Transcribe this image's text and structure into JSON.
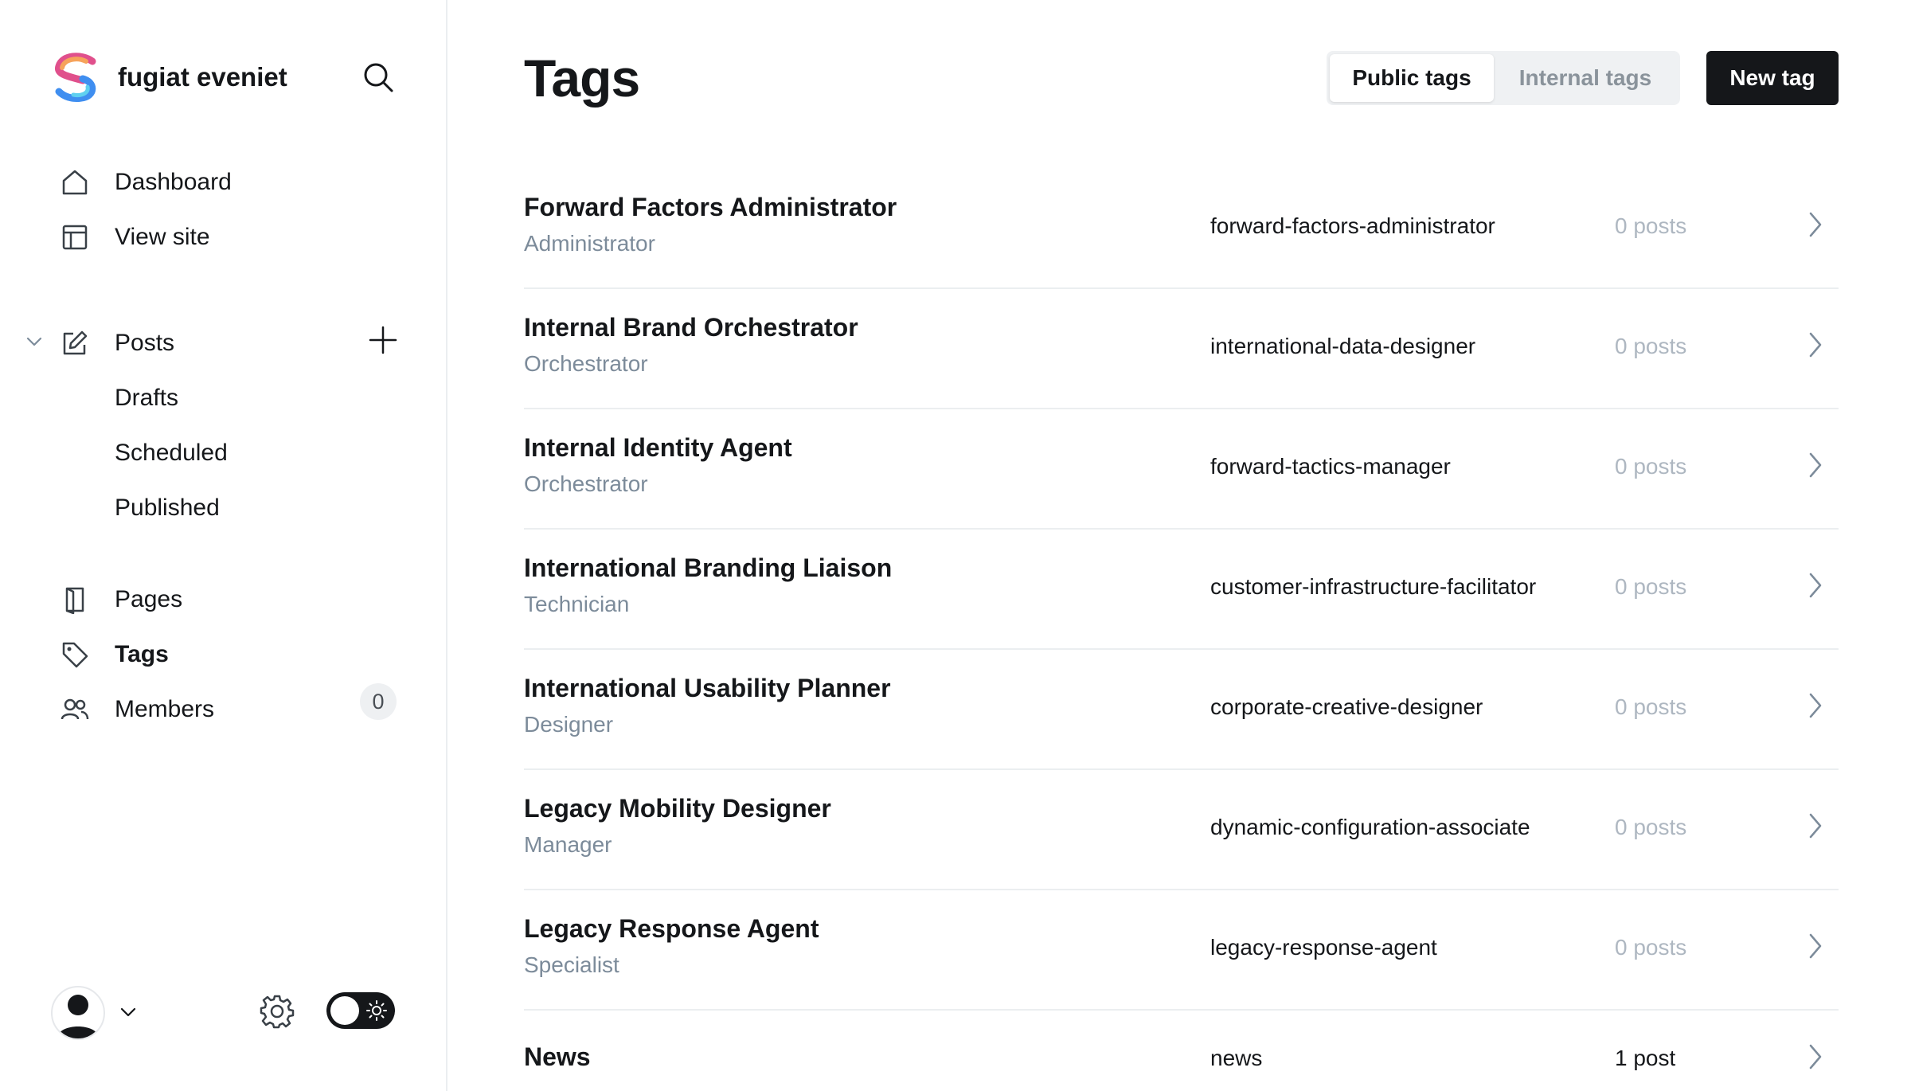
{
  "site": {
    "name": "fugiat eveniet"
  },
  "sidebar": {
    "nav": [
      {
        "key": "dashboard",
        "label": "Dashboard",
        "icon": "home-icon"
      },
      {
        "key": "view-site",
        "label": "View site",
        "icon": "layout-icon"
      }
    ],
    "posts": {
      "label": "Posts",
      "icon": "edit-icon",
      "subitems": [
        "Drafts",
        "Scheduled",
        "Published"
      ]
    },
    "secondary": [
      {
        "key": "pages",
        "label": "Pages",
        "icon": "page-icon"
      },
      {
        "key": "tags",
        "label": "Tags",
        "icon": "tag-icon",
        "active": true
      },
      {
        "key": "members",
        "label": "Members",
        "icon": "members-icon"
      }
    ],
    "members_count": "0"
  },
  "header": {
    "title": "Tags",
    "filters": {
      "public": "Public tags",
      "internal": "Internal tags",
      "active": "public"
    },
    "new_button": "New tag"
  },
  "tags": [
    {
      "name": "Forward Factors Administrator",
      "description": "Administrator",
      "slug": "forward-factors-administrator",
      "count": "0 posts"
    },
    {
      "name": "Internal Brand Orchestrator",
      "description": "Orchestrator",
      "slug": "international-data-designer",
      "count": "0 posts"
    },
    {
      "name": "Internal Identity Agent",
      "description": "Orchestrator",
      "slug": "forward-tactics-manager",
      "count": "0 posts"
    },
    {
      "name": "International Branding Liaison",
      "description": "Technician",
      "slug": "customer-infrastructure-facilitator",
      "count": "0 posts"
    },
    {
      "name": "International Usability Planner",
      "description": "Designer",
      "slug": "corporate-creative-designer",
      "count": "0 posts"
    },
    {
      "name": "Legacy Mobility Designer",
      "description": "Manager",
      "slug": "dynamic-configuration-associate",
      "count": "0 posts"
    },
    {
      "name": "Legacy Response Agent",
      "description": "Specialist",
      "slug": "legacy-response-agent",
      "count": "0 posts"
    },
    {
      "name": "News",
      "description": "",
      "slug": "news",
      "count": "1 post"
    }
  ],
  "colors": {
    "text": "#15171a",
    "muted": "#7c8b9a",
    "count_zero": "#aeb7c1",
    "divider": "#ebeef0",
    "primary_button": "#15171a"
  }
}
